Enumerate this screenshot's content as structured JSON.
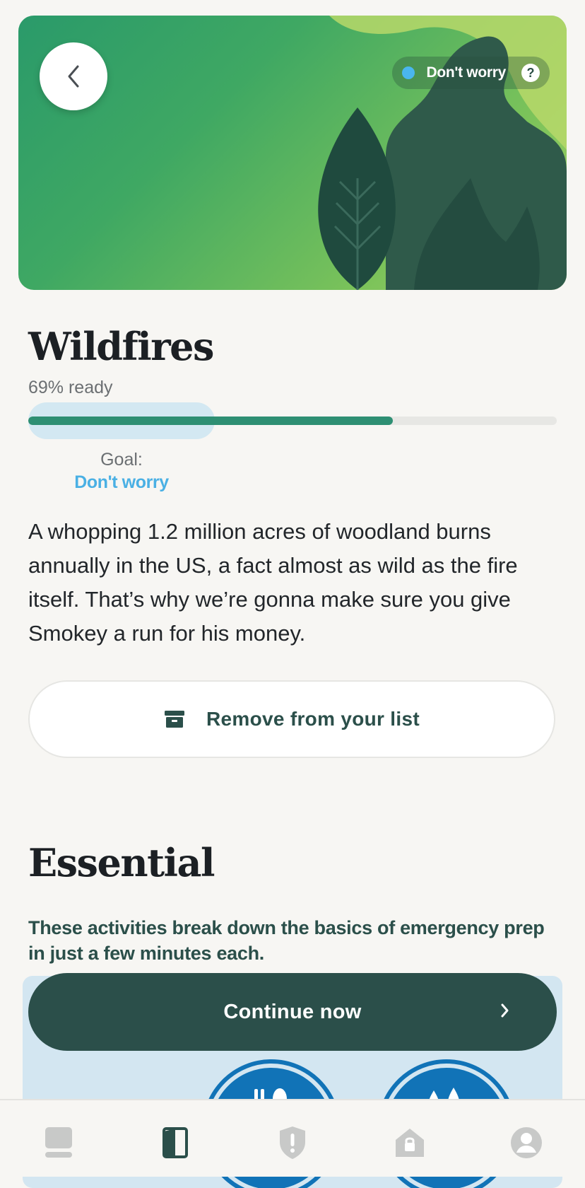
{
  "header": {
    "back_icon": "chevron-left-icon",
    "status_label": "Don't worry",
    "status_color": "#4ab6ee",
    "help_glyph": "?"
  },
  "topic": {
    "title": "Wildfires",
    "ready_text": "69% ready",
    "progress_percent": 69,
    "goal_label": "Goal:",
    "goal_value": "Don't worry",
    "description": "A whopping 1.2 million acres of woodland burns annually in the US, a fact almost as wild as the fire itself. That’s why we’re gonna make sure you give Smokey a run for his money.",
    "remove_button_label": "Remove from your list"
  },
  "essential": {
    "title": "Essential",
    "subtitle": "These activities break down the basics of emergency prep in just a few minutes each.",
    "continue_label": "Continue now",
    "activities": [
      {
        "icon": "fork-spoon-icon"
      },
      {
        "icon": "water-drops-icon"
      }
    ]
  },
  "tabbar": {
    "tabs": [
      {
        "icon": "home-icon",
        "active": false
      },
      {
        "icon": "book-icon",
        "active": true
      },
      {
        "icon": "shield-alert-icon",
        "active": false
      },
      {
        "icon": "lock-icon",
        "active": false
      },
      {
        "icon": "profile-icon",
        "active": false
      }
    ]
  },
  "colors": {
    "brand_dark": "#2b4f4a",
    "accent_blue": "#4ab0e4",
    "progress": "#2e8f73",
    "panel_blue": "#d3e6f1",
    "activity_blue": "#1173b7"
  }
}
